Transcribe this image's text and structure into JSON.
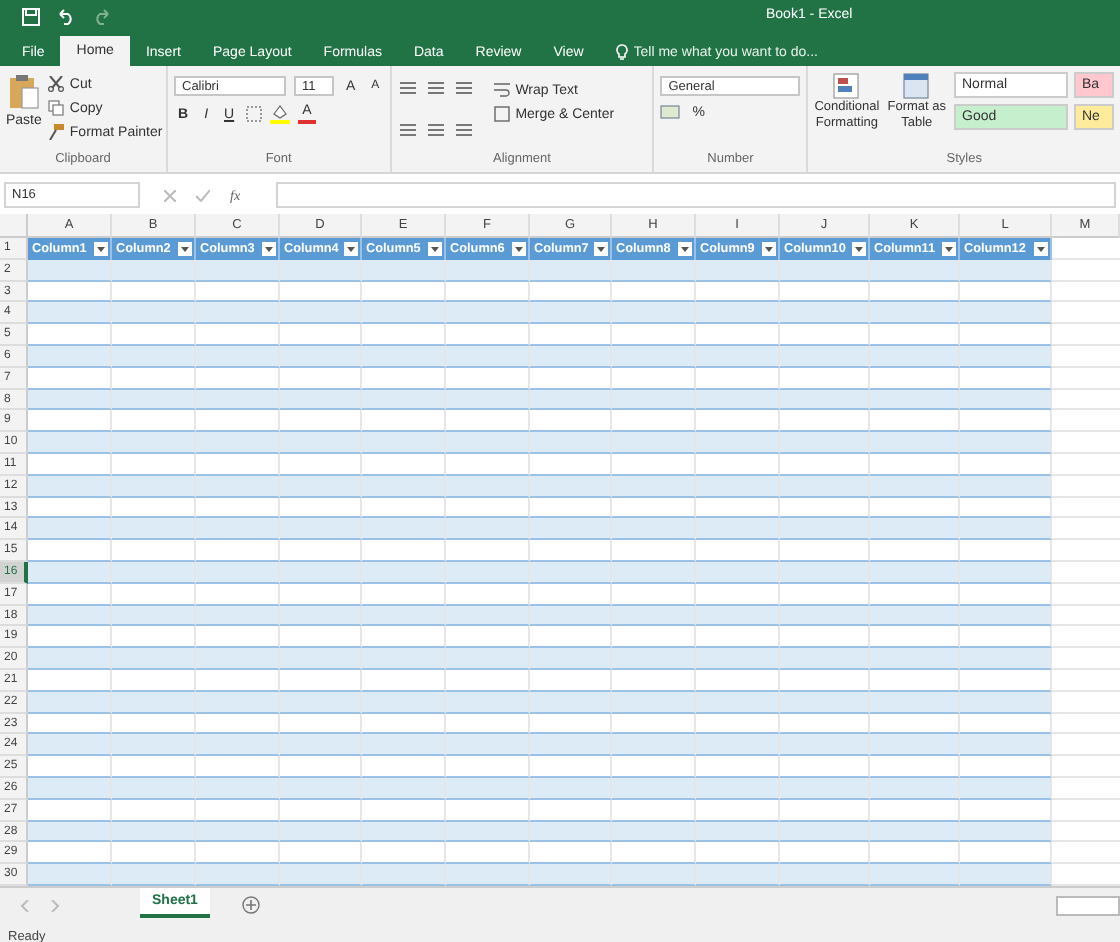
{
  "window": {
    "title": "Book1 - Excel"
  },
  "tabs": [
    {
      "label": "File",
      "selected": false
    },
    {
      "label": "Home",
      "selected": true
    },
    {
      "label": "Insert",
      "selected": false
    },
    {
      "label": "Page Layout",
      "selected": false
    },
    {
      "label": "Formulas",
      "selected": false
    },
    {
      "label": "Data",
      "selected": false
    },
    {
      "label": "Review",
      "selected": false
    },
    {
      "label": "View",
      "selected": false
    }
  ],
  "tell_me": {
    "placeholder": "Tell me what you want to do..."
  },
  "clipboard": {
    "paste": "Paste",
    "cut": "Cut",
    "copy": "Copy",
    "format_painter": "Format Painter",
    "label": "Clipboard"
  },
  "font": {
    "family": "Calibri",
    "size": "11",
    "bold": "B",
    "italic": "I",
    "underline": "U",
    "grow": "A",
    "shrink": "A",
    "color_button": "A",
    "label": "Font"
  },
  "alignment": {
    "wrap": "Wrap Text",
    "merge": "Merge & Center",
    "label": "Alignment"
  },
  "number": {
    "format": "General",
    "percent": "%",
    "label": "Number"
  },
  "styles": {
    "conditional": [
      "Conditional",
      "Formatting"
    ],
    "format_table": [
      "Format as",
      "Table"
    ],
    "cells": [
      {
        "label": "Normal",
        "color": "#ffffff"
      },
      {
        "label": "Ba",
        "color": "#ffc7ce"
      },
      {
        "label": "Good",
        "color": "#c6efce"
      },
      {
        "label": "Ne",
        "color": "#ffeb9c"
      }
    ],
    "label": "Styles"
  },
  "formula_bar": {
    "name_box": "N16",
    "fx": "fx"
  },
  "columns": [
    "A",
    "B",
    "C",
    "D",
    "E",
    "F",
    "G",
    "H",
    "I",
    "J",
    "K",
    "L",
    "M"
  ],
  "table_headers": [
    "Column1",
    "Column2",
    "Column3",
    "Column4",
    "Column5",
    "Column6",
    "Column7",
    "Column8",
    "Column9",
    "Column10",
    "Column11",
    "Column12"
  ],
  "rows": [
    {
      "number": "1",
      "selected": false
    },
    {
      "number": "2",
      "selected": false
    },
    {
      "number": "3",
      "selected": false
    },
    {
      "number": "4",
      "selected": false
    },
    {
      "number": "5",
      "selected": false
    },
    {
      "number": "6",
      "selected": false
    },
    {
      "number": "7",
      "selected": false
    },
    {
      "number": "8",
      "selected": false
    },
    {
      "number": "9",
      "selected": false
    },
    {
      "number": "10",
      "selected": false
    },
    {
      "number": "11",
      "selected": false
    },
    {
      "number": "12",
      "selected": false
    },
    {
      "number": "13",
      "selected": false
    },
    {
      "number": "14",
      "selected": false
    },
    {
      "number": "15",
      "selected": false
    },
    {
      "number": "16",
      "selected": true
    },
    {
      "number": "17",
      "selected": false
    },
    {
      "number": "18",
      "selected": false
    },
    {
      "number": "19",
      "selected": false
    },
    {
      "number": "20",
      "selected": false
    },
    {
      "number": "21",
      "selected": false
    },
    {
      "number": "22",
      "selected": false
    },
    {
      "number": "23",
      "selected": false
    },
    {
      "number": "24",
      "selected": false
    },
    {
      "number": "25",
      "selected": false
    },
    {
      "number": "26",
      "selected": false
    },
    {
      "number": "27",
      "selected": false
    },
    {
      "number": "28",
      "selected": false
    },
    {
      "number": "29",
      "selected": false
    },
    {
      "number": "30",
      "selected": false
    }
  ],
  "sheets": [
    {
      "label": "Sheet1",
      "selected": true
    }
  ],
  "status_bar": {
    "text": "Ready"
  }
}
